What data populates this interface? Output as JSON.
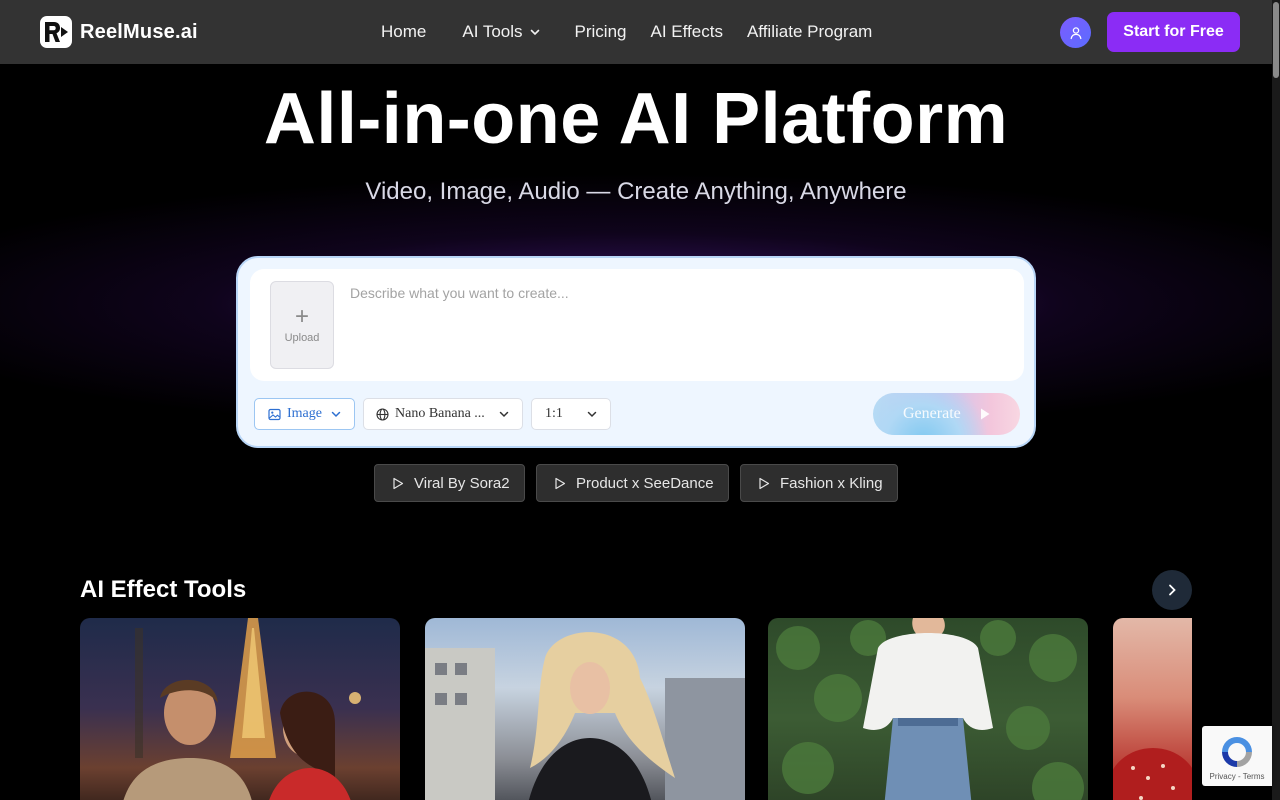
{
  "nav": {
    "brand": "ReelMuse.ai",
    "links": [
      "Home",
      "AI Tools",
      "Pricing",
      "AI Effects",
      "Affiliate Program"
    ],
    "start_label": "Start for Free"
  },
  "hero": {
    "title": "All-in-one AI Platform",
    "subtitle": "Video, Image, Audio — Create Anything, Anywhere"
  },
  "prompt": {
    "upload_label": "Upload",
    "placeholder": "Describe what you want to create...",
    "type_value": "Image",
    "model_value": "Nano Banana ...",
    "ratio_value": "1:1",
    "generate_label": "Generate"
  },
  "chips": [
    "Viral By Sora2",
    "Product x SeeDance",
    "Fashion x Kling"
  ],
  "effects": {
    "title": "AI Effect Tools"
  },
  "recaptcha": {
    "text": "Privacy - Terms"
  },
  "colors": {
    "accent": "#8b2cf5",
    "nav_bg": "#333333",
    "card_bg": "#eef6ff"
  }
}
